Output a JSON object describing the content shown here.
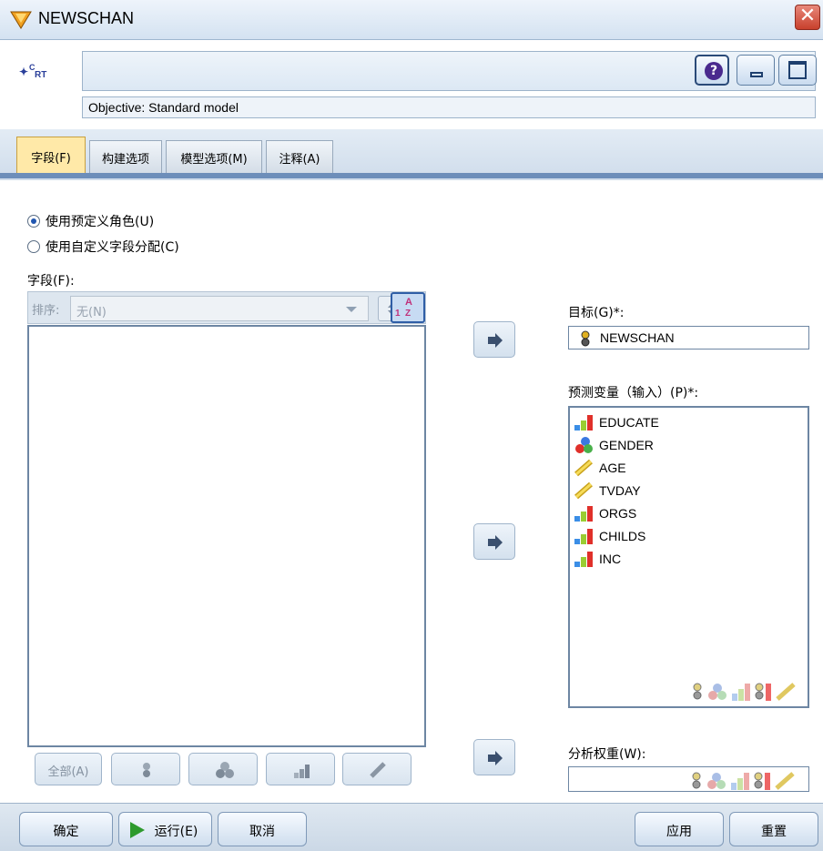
{
  "window": {
    "title": "NEWSCHAN",
    "close": "✕"
  },
  "header": {
    "node_icon_text": "C&RT",
    "node_name": "",
    "objective": "Objective: Standard model"
  },
  "tabs": [
    {
      "label": "字段(F)",
      "active": true
    },
    {
      "label": "构建选项",
      "active": false
    },
    {
      "label": "模型选项(M)",
      "active": false
    },
    {
      "label": "注释(A)",
      "active": false
    }
  ],
  "roles": {
    "predefined_label": "使用预定义角色(U)",
    "predefined_selected": true,
    "custom_label": "使用自定义字段分配(C)",
    "custom_selected": false
  },
  "fields_panel": {
    "label": "字段(F):",
    "sort_label": "排序:",
    "sort_value": "无(N)",
    "items": [],
    "filters": {
      "all_label": "全部(A)"
    }
  },
  "target": {
    "label": "目标(G)*:",
    "value": "NEWSCHAN",
    "icon": "flag-icon"
  },
  "predictors": {
    "label": "预测变量（输入）(P)*:",
    "items": [
      {
        "name": "EDUCATE",
        "icon": "ordinal-icon"
      },
      {
        "name": "GENDER",
        "icon": "nominal-icon"
      },
      {
        "name": "AGE",
        "icon": "continuous-icon"
      },
      {
        "name": "TVDAY",
        "icon": "continuous-icon"
      },
      {
        "name": "ORGS",
        "icon": "ordinal-icon"
      },
      {
        "name": "CHILDS",
        "icon": "ordinal-icon"
      },
      {
        "name": "INC",
        "icon": "ordinal-icon"
      }
    ]
  },
  "weight": {
    "label": "分析权重(W):",
    "value": ""
  },
  "footer": {
    "ok": "确定",
    "run": "运行(E)",
    "cancel": "取消",
    "apply": "应用",
    "reset": "重置"
  },
  "colors": {
    "accent_tab": "#ffe9a8",
    "tab_underline": "#6d8eba",
    "run_play": "#2d9a2d",
    "close": "#c8402c"
  }
}
